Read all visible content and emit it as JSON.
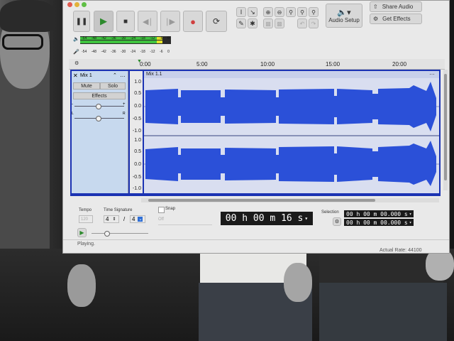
{
  "toolbar": {
    "audio_setup_label": "Audio Setup",
    "share_audio_label": "Share Audio",
    "get_effects_label": "Get Effects"
  },
  "meters": {
    "playback_scale": [
      "-54",
      "-48",
      "-42",
      "-36",
      "-30",
      "-24",
      "-18",
      "-12",
      "-6",
      "0"
    ],
    "record_scale": [
      "-54",
      "-48",
      "-42",
      "-36",
      "-30",
      "-24",
      "-18",
      "-12",
      "-6",
      "0"
    ]
  },
  "timeline": {
    "ticks": [
      "0:00",
      "5:00",
      "10:00",
      "15:00",
      "20:00"
    ]
  },
  "track": {
    "name": "Mix 1",
    "clip_name": "Mix 1.1",
    "mute_label": "Mute",
    "solo_label": "Solo",
    "effects_label": "Effects",
    "pan_left": "L",
    "pan_right": "R",
    "scale_top": [
      "1.0",
      "0.5",
      "0.0",
      "-0.5",
      "-1.0"
    ],
    "scale_bottom": [
      "1.0",
      "0.5",
      "0.0",
      "-0.5",
      "-1.0"
    ]
  },
  "bottom": {
    "tempo_label": "Tempo",
    "tempo_value": "120",
    "time_signature_label": "Time Signature",
    "ts_numerator": "4",
    "ts_slash": "/",
    "ts_denominator": "4",
    "snap_label": "Snap",
    "snap_value": "Off",
    "time_display": "00 h 00 m 16 s",
    "selection_label": "Selection",
    "selection_start": "00 h 00 m 00.000 s",
    "selection_end": "00 h 00 m 00.000 s"
  },
  "status": {
    "state": "Playing.",
    "actual_rate": "Actual Rate: 44100"
  },
  "colors": {
    "waveform": "#2b50d8",
    "track_selected": "#1b33b3",
    "meter_green": "#3fc23f",
    "meter_yellow": "#e2e22a"
  }
}
